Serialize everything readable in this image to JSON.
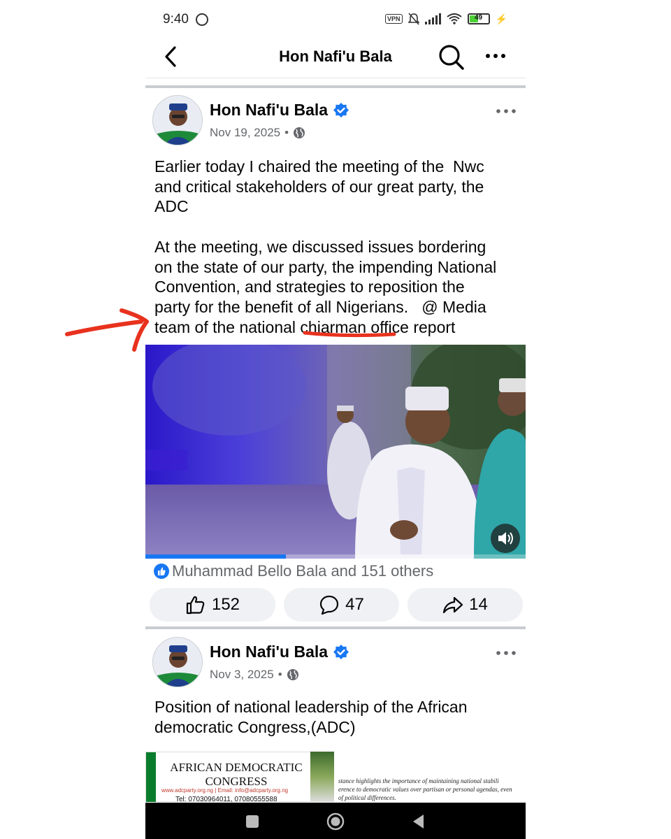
{
  "status_bar": {
    "time": "9:40",
    "vpn": "VPN",
    "battery": "49",
    "battery_level": 0.49
  },
  "header": {
    "title": "Hon Nafi'u Bala"
  },
  "post1": {
    "author": "Hon Nafi'u Bala",
    "date": "Nov 19, 2025",
    "separator": "•",
    "text": "Earlier today I chaired the meeting of the  Nwc\nand critical stakeholders of our great party, the\nADC\n\nAt the meeting, we discussed issues bordering\non the state of our party, the impending National\nConvention, and strategies to reposition the\nparty for the benefit of all Nigerians.   @ Media\nteam of the national chiarman office report",
    "video_progress": 0.37,
    "reactions_text": "Muhammad Bello Bala and 151 others",
    "likes": "152",
    "comments": "47",
    "shares": "14"
  },
  "post2": {
    "author": "Hon Nafi'u Bala",
    "date": "Nov 3, 2025",
    "separator": "•",
    "text": "Position of national leadership of the African\ndemocratic Congress,(ADC)",
    "ad": {
      "title_line1": "AFRICAN DEMOCRATIC",
      "title_line2": "CONGRESS",
      "contact": "www.adcparty.org.ng | Email: info@adcparty.org.ng",
      "tel": "Tel: 07030964011, 07080555588",
      "quote": "stance highlights the importance of maintaining national stabili\nerence to democratic values over partisan or personal agendas, even\nof political differences."
    }
  },
  "colors": {
    "accent": "#1877f2",
    "annotation": "#e8321e",
    "muted": "#65676b"
  }
}
